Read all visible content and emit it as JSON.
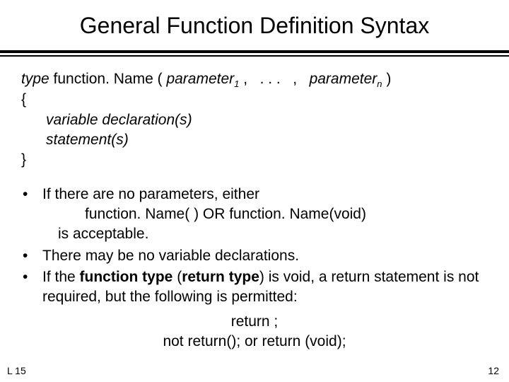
{
  "title": "General Function Definition Syntax",
  "syntax": {
    "type": "type",
    "funcname": " function. Name ( ",
    "param_prefix": "parameter",
    "sub1": "1",
    "mid": " ,   . . .   ,   ",
    "subn": "n",
    "close": " )",
    "brace_open": "{",
    "var_decl": "variable declaration(s)",
    "statements": "statement(s)",
    "brace_close": "}"
  },
  "bullets": [
    {
      "lines": [
        "If there are no parameters, either",
        "function. Name( )   OR   function. Name(void)",
        "is acceptable."
      ],
      "indent_mode": "param"
    },
    {
      "lines": [
        "There may be no variable declarations."
      ],
      "indent_mode": "plain"
    }
  ],
  "bullet3": {
    "pre": "If the ",
    "b1": "function type",
    "mid1": " (",
    "b2": "return type",
    "post": ") is void, a return statement is not required, but the following is permitted:"
  },
  "tail": {
    "line1": "return ;",
    "line2": "not  return();    or   return (void);"
  },
  "footer": {
    "left": "L 15",
    "right": "12"
  }
}
